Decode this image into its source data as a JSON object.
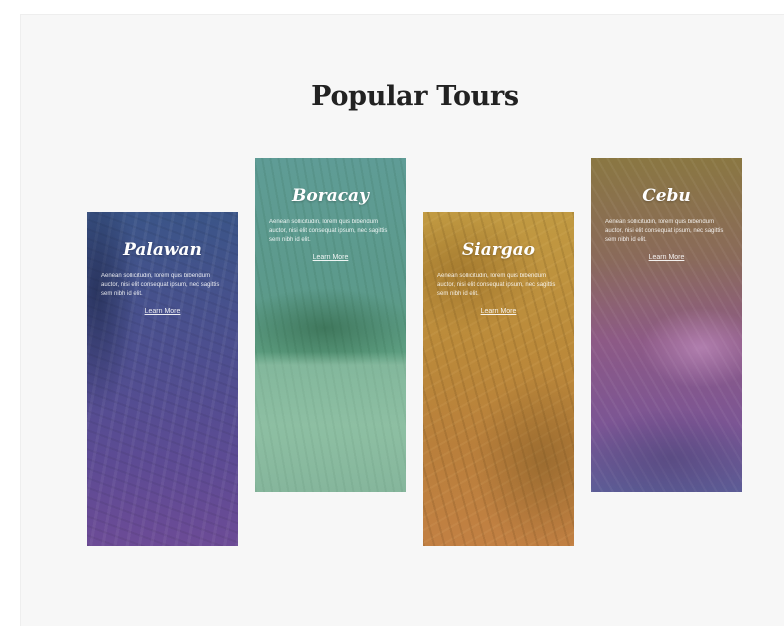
{
  "section": {
    "title": "Popular Tours"
  },
  "tours": [
    {
      "name": "Palawan",
      "description": "Aenean sollicitudin, lorem quis bibendum auctor, nisi elit consequat ipsum, nec sagittis sem nibh id elit.",
      "link_label": "Learn More"
    },
    {
      "name": "Boracay",
      "description": "Aenean sollicitudin, lorem quis bibendum auctor, nisi elit consequat ipsum, nec sagittis sem nibh id elit.",
      "link_label": "Learn More"
    },
    {
      "name": "Siargao",
      "description": "Aenean sollicitudin, lorem quis bibendum auctor, nisi elit consequat ipsum, nec sagittis sem nibh id elit.",
      "link_label": "Learn More"
    },
    {
      "name": "Cebu",
      "description": "Aenean sollicitudin, lorem quis bibendum auctor, nisi elit consequat ipsum, nec sagittis sem nibh id elit.",
      "link_label": "Learn More"
    }
  ],
  "colors": {
    "page_background": "#f7f7f7",
    "title_color": "#222222",
    "palawan_tint": "#4c4f8f",
    "boracay_tint": "#5c9a8b",
    "siargao_tint": "#bb8a3a",
    "cebu_tint": "#8d5a86"
  }
}
